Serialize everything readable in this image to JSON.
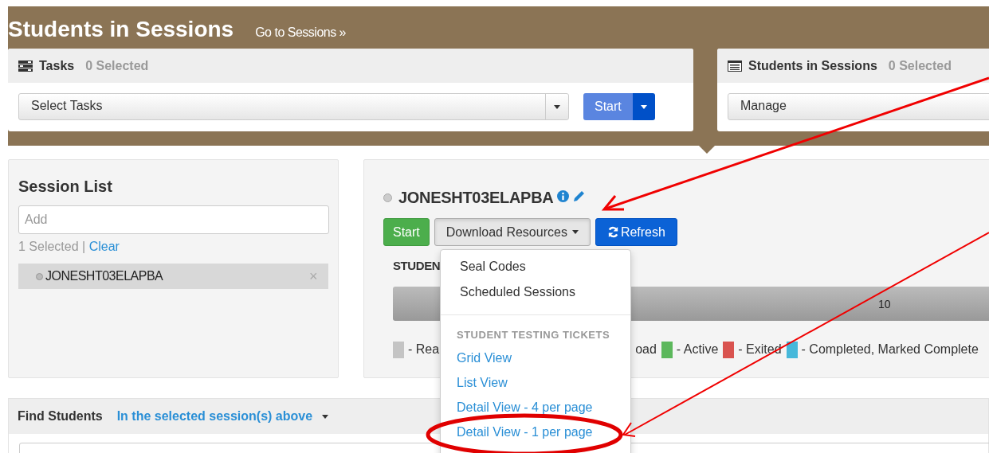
{
  "header": {
    "title": "Students in Sessions",
    "link": "Go to Sessions »"
  },
  "panels": [
    {
      "kind": "tasks",
      "title": "Tasks",
      "count": "0 Selected",
      "select": "Select Tasks",
      "button": "Start"
    },
    {
      "kind": "students",
      "title": "Students in Sessions",
      "count": "0 Selected",
      "select": "Manage"
    }
  ],
  "session_list": {
    "title": "Session List",
    "placeholder": "Add",
    "selected_count": "1 Selected",
    "separator": "|",
    "clear": "Clear",
    "items": [
      {
        "name": "JONESHT03ELAPBA",
        "remove": "×",
        "selected": true
      }
    ]
  },
  "session": {
    "name": "JONESHT03ELAPBA",
    "buttons": [
      {
        "kind": "start",
        "label": "Start"
      },
      {
        "kind": "dropdown",
        "label": "Download Resources"
      },
      {
        "kind": "refresh",
        "label": "Refresh"
      }
    ],
    "students_heading": "STUDEN",
    "progress": {
      "label": "10",
      "level": 1
    },
    "legend": [
      {
        "label": "- Rea",
        "color": "#c4c4c4"
      },
      {
        "label": "oad"
      },
      {
        "label": "- Active",
        "color": "#5cb85c"
      },
      {
        "label": "- Exited",
        "color": "#d9534f"
      },
      {
        "label": "- Completed, Marked Complete",
        "color": "#46b8da"
      }
    ]
  },
  "menu": [
    {
      "kind": "item",
      "label": "Seal Codes"
    },
    {
      "kind": "item",
      "label": "Scheduled Sessions"
    },
    {
      "kind": "divider"
    },
    {
      "kind": "header",
      "label": "STUDENT TESTING TICKETS"
    },
    {
      "kind": "link",
      "label": "Grid View"
    },
    {
      "kind": "link",
      "label": "List View"
    },
    {
      "kind": "link",
      "label": "Detail View - 4 per page"
    },
    {
      "kind": "link",
      "label": "Detail View - 1 per page"
    }
  ],
  "find": {
    "title": "Find Students",
    "scope": "In the selected session(s) above"
  }
}
